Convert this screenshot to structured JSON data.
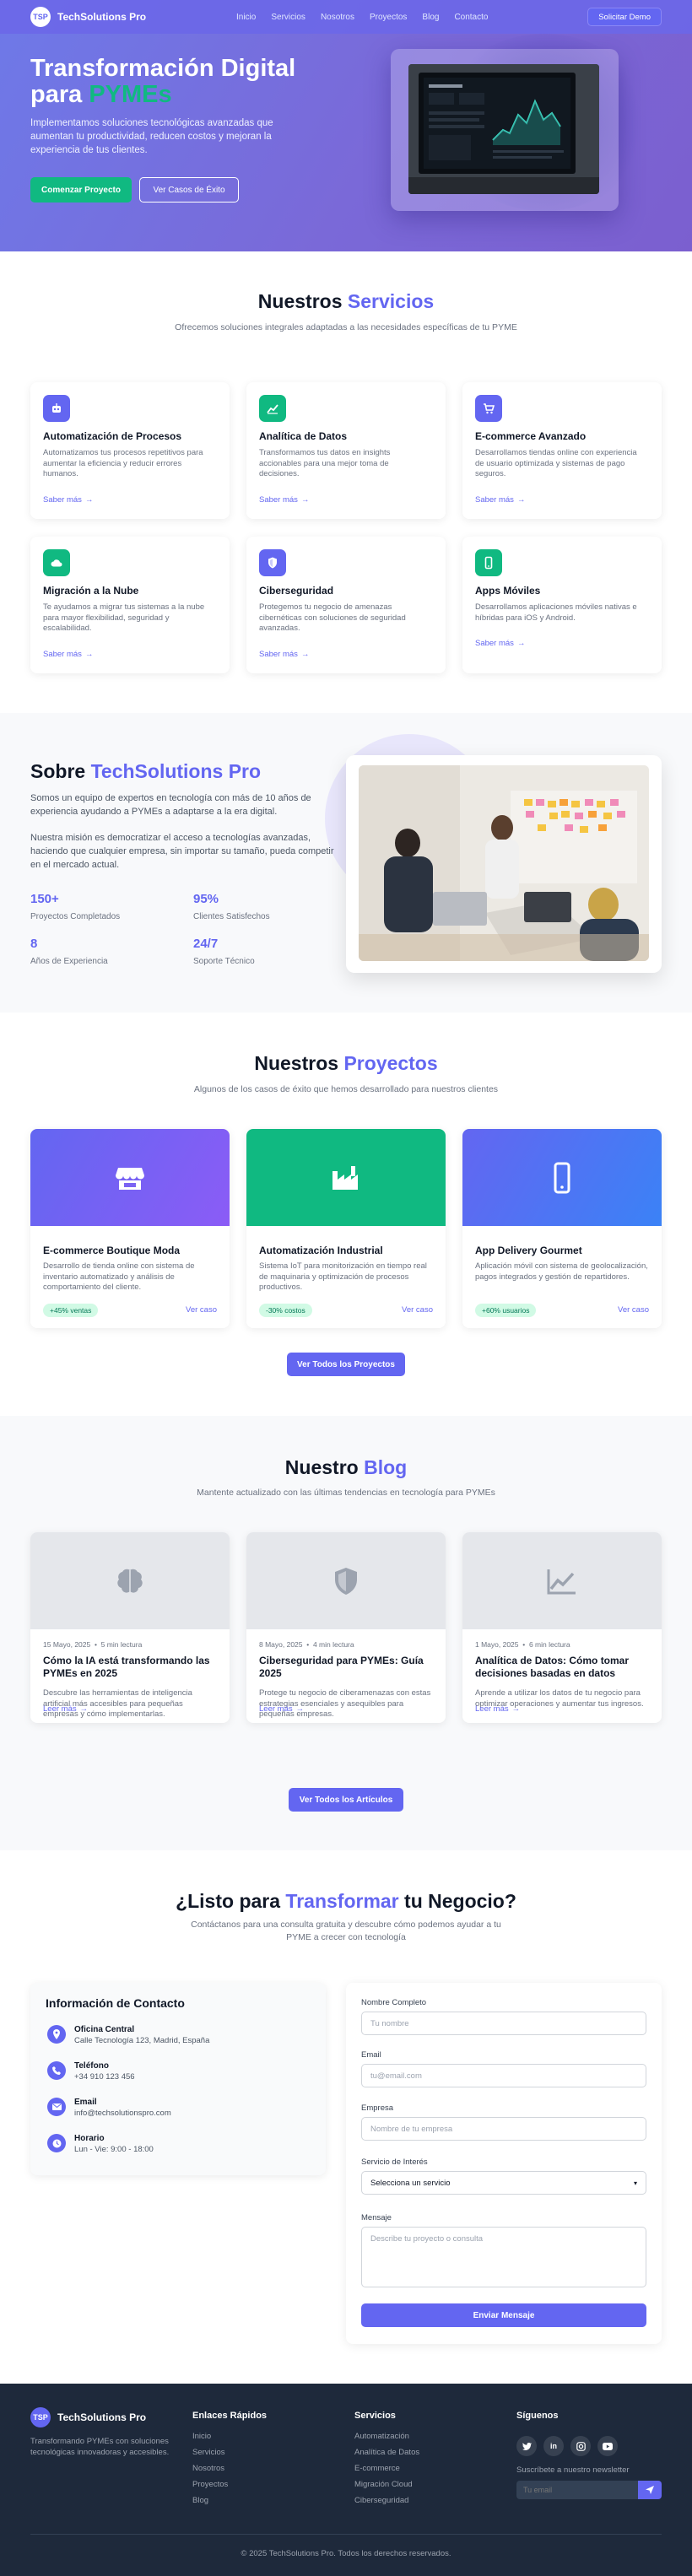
{
  "nav": {
    "logo_badge": "TSP",
    "brand": "TechSolutions Pro",
    "links": [
      "Inicio",
      "Servicios",
      "Nosotros",
      "Proyectos",
      "Blog",
      "Contacto"
    ],
    "cta": "Solicitar Demo"
  },
  "hero": {
    "title_part1": "Transformación Digital para ",
    "title_highlight": "PYMEs",
    "description": "Implementamos soluciones tecnológicas avanzadas que aumentan tu productividad, reducen costos y mejoran la experiencia de tus clientes.",
    "primary_button": "Comenzar Proyecto",
    "secondary_button": "Ver Casos de Éxito"
  },
  "services": {
    "title_part1": "Nuestros ",
    "title_highlight": "Servicios",
    "subtitle": "Ofrecemos soluciones integrales adaptadas a las necesidades específicas de tu PYME",
    "more_label": "Saber más",
    "items": [
      {
        "title": "Automatización de Procesos",
        "desc": "Automatizamos tus procesos repetitivos para aumentar la eficiencia y reducir errores humanos.",
        "icon": "robot-icon",
        "color": "#6366f1"
      },
      {
        "title": "Analítica de Datos",
        "desc": "Transformamos tus datos en insights accionables para una mejor toma de decisiones.",
        "icon": "chart-line-icon",
        "color": "#10b981"
      },
      {
        "title": "E-commerce Avanzado",
        "desc": "Desarrollamos tiendas online con experiencia de usuario optimizada y sistemas de pago seguros.",
        "icon": "shopping-cart-icon",
        "color": "#6366f1"
      },
      {
        "title": "Migración a la Nube",
        "desc": "Te ayudamos a migrar tus sistemas a la nube para mayor flexibilidad, seguridad y escalabilidad.",
        "icon": "cloud-icon",
        "color": "#10b981"
      },
      {
        "title": "Ciberseguridad",
        "desc": "Protegemos tu negocio de amenazas cibernéticas con soluciones de seguridad avanzadas.",
        "icon": "shield-icon",
        "color": "#6366f1"
      },
      {
        "title": "Apps Móviles",
        "desc": "Desarrollamos aplicaciones móviles nativas e híbridas para iOS y Android.",
        "icon": "mobile-icon",
        "color": "#10b981"
      }
    ]
  },
  "about": {
    "title_part1": "Sobre ",
    "title_highlight": "TechSolutions Pro",
    "para1": "Somos un equipo de expertos en tecnología con más de 10 años de experiencia ayudando a PYMEs a adaptarse a la era digital.",
    "para2": "Nuestra misión es democratizar el acceso a tecnologías avanzadas, haciendo que cualquier empresa, sin importar su tamaño, pueda competir en el mercado actual.",
    "stats": [
      {
        "value": "150+",
        "label": "Proyectos Completados"
      },
      {
        "value": "95%",
        "label": "Clientes Satisfechos"
      },
      {
        "value": "8",
        "label": "Años de Experiencia"
      },
      {
        "value": "24/7",
        "label": "Soporte Técnico"
      }
    ]
  },
  "projects": {
    "title_part1": "Nuestros ",
    "title_highlight": "Proyectos",
    "subtitle": "Algunos de los casos de éxito que hemos desarrollado para nuestros clientes",
    "view_label": "Ver caso",
    "button": "Ver Todos los Proyectos",
    "items": [
      {
        "title": "E-commerce Boutique Moda",
        "desc": "Desarrollo de tienda online con sistema de inventario automatizado y análisis de comportamiento del cliente.",
        "badge": "+45% ventas",
        "icon": "store-icon"
      },
      {
        "title": "Automatización Industrial",
        "desc": "Sistema IoT para monitorización en tiempo real de maquinaria y optimización de procesos productivos.",
        "badge": "-30% costos",
        "icon": "factory-icon"
      },
      {
        "title": "App Delivery Gourmet",
        "desc": "Aplicación móvil con sistema de geolocalización, pagos integrados y gestión de repartidores.",
        "badge": "+60% usuarios",
        "icon": "mobile-icon"
      }
    ]
  },
  "blog": {
    "title_part1": "Nuestro ",
    "title_highlight": "Blog",
    "subtitle": "Mantente actualizado con las últimas tendencias en tecnología para PYMEs",
    "read_label": "Leer más",
    "button": "Ver Todos los Artículos",
    "posts": [
      {
        "date": "15 Mayo, 2025",
        "read": "5 min lectura",
        "title": "Cómo la IA está transformando las PYMEs en 2025",
        "desc": "Descubre las herramientas de inteligencia artificial más accesibles para pequeñas empresas y cómo implementarlas.",
        "icon": "brain-icon"
      },
      {
        "date": "8 Mayo, 2025",
        "read": "4 min lectura",
        "title": "Ciberseguridad para PYMEs: Guía 2025",
        "desc": "Protege tu negocio de ciberamenazas con estas estrategias esenciales y asequibles para pequeñas empresas.",
        "icon": "shield-icon"
      },
      {
        "date": "1 Mayo, 2025",
        "read": "6 min lectura",
        "title": "Analítica de Datos: Cómo tomar decisiones basadas en datos",
        "desc": "Aprende a utilizar los datos de tu negocio para optimizar operaciones y aumentar tus ingresos.",
        "icon": "chart-line-icon"
      }
    ]
  },
  "contact": {
    "title_part1": "¿Listo para ",
    "title_highlight": "Transformar",
    "title_part2": " tu Negocio?",
    "subtitle": "Contáctanos para una consulta gratuita y descubre cómo podemos ayudar a tu PYME a crecer con tecnología",
    "info_title": "Información de Contacto",
    "info": [
      {
        "label": "Oficina Central",
        "value": "Calle Tecnología 123, Madrid, España",
        "icon": "location-icon"
      },
      {
        "label": "Teléfono",
        "value": "+34 910 123 456",
        "icon": "phone-icon"
      },
      {
        "label": "Email",
        "value": "info@techsolutionspro.com",
        "icon": "envelope-icon"
      },
      {
        "label": "Horario",
        "value": "Lun - Vie: 9:00 - 18:00",
        "icon": "clock-icon"
      }
    ],
    "form": {
      "name_label": "Nombre Completo",
      "name_placeholder": "Tu nombre",
      "email_label": "Email",
      "email_placeholder": "tu@email.com",
      "company_label": "Empresa",
      "company_placeholder": "Nombre de tu empresa",
      "service_label": "Servicio de Interés",
      "service_selected": "Selecciona un servicio",
      "message_label": "Mensaje",
      "message_placeholder": "Describe tu proyecto o consulta",
      "submit": "Enviar Mensaje"
    }
  },
  "footer": {
    "brand": "TechSolutions Pro",
    "logo_badge": "TSP",
    "description": "Transformando PYMEs con soluciones tecnológicas innovadoras y accesibles.",
    "quick_title": "Enlaces Rápidos",
    "quick_links": [
      "Inicio",
      "Servicios",
      "Nosotros",
      "Proyectos",
      "Blog"
    ],
    "services_title": "Servicios",
    "service_links": [
      "Automatización",
      "Analítica de Datos",
      "E-commerce",
      "Migración Cloud",
      "Ciberseguridad"
    ],
    "follow_title": "Síguenos",
    "social": [
      "twitter-icon",
      "linkedin-icon",
      "instagram-icon",
      "youtube-icon"
    ],
    "newsletter_label": "Suscríbete a nuestro newsletter",
    "newsletter_placeholder": "Tu email",
    "copyright": "© 2025 TechSolutions Pro. Todos los derechos reservados."
  },
  "colors": {
    "primary": "#6366f1",
    "green": "#10b981",
    "footer_bg": "#1e293b"
  }
}
